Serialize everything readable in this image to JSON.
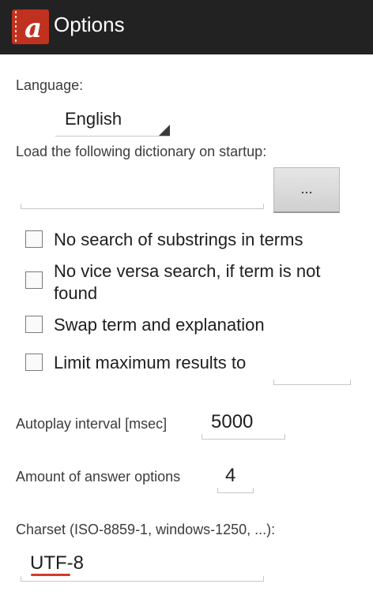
{
  "header": {
    "title": "Options",
    "icon": "app-logo-icon"
  },
  "language": {
    "label": "Language:",
    "selected": "English"
  },
  "dictionary": {
    "label": "Load the following dictionary on startup:",
    "value": "",
    "browse_label": "..."
  },
  "options": [
    {
      "label": "No search of substrings in terms",
      "checked": false
    },
    {
      "label": "No vice versa search, if term is not found",
      "checked": false
    },
    {
      "label": "Swap term and explanation",
      "checked": false
    },
    {
      "label": "Limit maximum results to",
      "checked": false
    }
  ],
  "max_results": {
    "value": ""
  },
  "autoplay": {
    "label": "Autoplay interval [msec]",
    "value": "5000"
  },
  "answers": {
    "label": "Amount of answer options",
    "value": "4"
  },
  "charset": {
    "label": "Charset (ISO-8859-1, windows-1250, ...):",
    "value": "UTF-8"
  },
  "colors": {
    "action_bar": "#222222",
    "logo": "#c1311f",
    "spellcheck": "#d33b2f"
  }
}
